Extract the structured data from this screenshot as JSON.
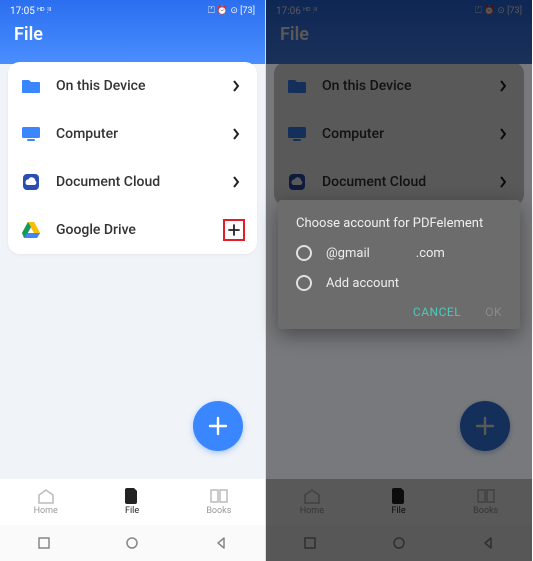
{
  "left": {
    "time": "17:05",
    "status_extra": "ᴴᴰ ⫶ᴵᴵ",
    "status_icons": "⏍ ⏰ ⊙ [73]",
    "title": "File",
    "sources": [
      {
        "label": "On this Device",
        "action": "chevron"
      },
      {
        "label": "Computer",
        "action": "chevron"
      },
      {
        "label": "Document Cloud",
        "action": "chevron"
      },
      {
        "label": "Google Drive",
        "action": "plus"
      }
    ],
    "tabs": {
      "home": "Home",
      "file": "File",
      "books": "Books"
    }
  },
  "right": {
    "time": "17:06",
    "status_extra": "ᴴᴰ ⫶ᴵᴵ",
    "status_icons": "⏍ ⏰ ⊙ [73]",
    "title": "File",
    "sources": [
      {
        "label": "On this Device",
        "action": "chevron"
      },
      {
        "label": "Computer",
        "action": "chevron"
      },
      {
        "label": "Document Cloud",
        "action": "chevron"
      }
    ],
    "tabs": {
      "home": "Home",
      "file": "File",
      "books": "Books"
    },
    "dialog": {
      "title": "Choose account for PDFelement",
      "email_user": ".com",
      "email_domain": "@gmail",
      "add_account": "Add account",
      "cancel": "CANCEL",
      "ok": "OK"
    }
  }
}
